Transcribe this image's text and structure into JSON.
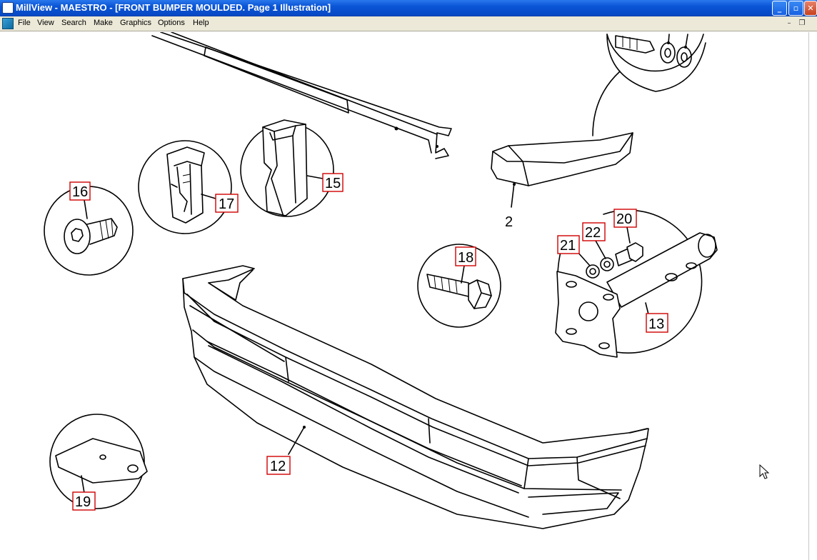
{
  "window": {
    "title": "MillView - MAESTRO - [FRONT BUMPER MOULDED. Page 1 Illustration]",
    "minimize_glyph": "_",
    "maximize_glyph": "▫",
    "close_glyph": "✕"
  },
  "menu": {
    "items": [
      "File",
      "View",
      "Search",
      "Make",
      "Graphics",
      "Options",
      "Help"
    ],
    "mdi_minimize_glyph": "–",
    "mdi_restore_glyph": "❐"
  },
  "illustration": {
    "callouts": {
      "c16": "16",
      "c17": "17",
      "c15": "15",
      "c18": "18",
      "c20": "20",
      "c21": "21",
      "c22": "22",
      "c13": "13",
      "c12": "12",
      "c19": "19"
    },
    "label_2": "2"
  },
  "icons": {
    "app": "millview-app-icon",
    "document": "illustration-document-icon",
    "cursor": "mouse-pointer-icon"
  }
}
